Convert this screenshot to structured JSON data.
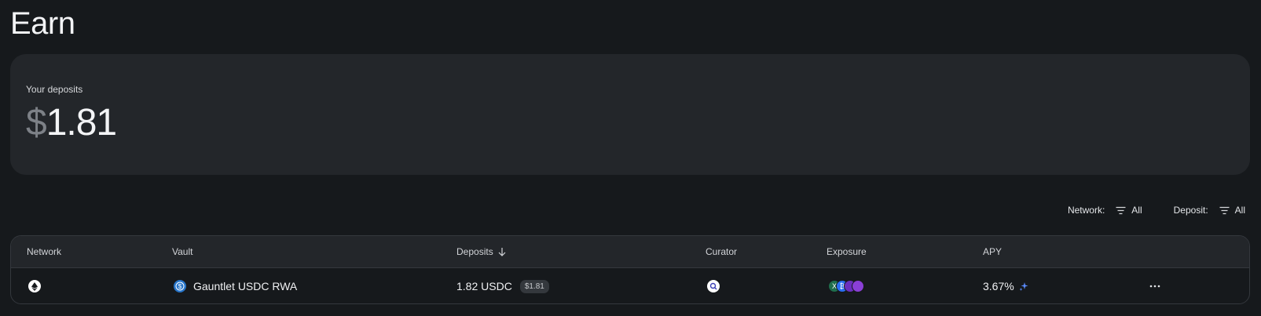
{
  "page": {
    "title": "Earn"
  },
  "summary": {
    "label": "Your deposits",
    "currency_symbol": "$",
    "amount": "1.81"
  },
  "filters": {
    "network": {
      "label": "Network:",
      "value": "All"
    },
    "deposit": {
      "label": "Deposit:",
      "value": "All"
    }
  },
  "table": {
    "columns": {
      "network": "Network",
      "vault": "Vault",
      "deposits": "Deposits",
      "curator": "Curator",
      "exposure": "Exposure",
      "apy": "APY"
    },
    "rows": [
      {
        "network_icon": "ethereum-icon",
        "vault_icon": "usdc-icon",
        "vault": "Gauntlet USDC RWA",
        "deposits": "1.82 USDC",
        "deposits_usd": "$1.81",
        "curator_icon": "gauntlet-curator-icon",
        "exposure_icons": [
          "xaut-icon",
          "wbtc-icon",
          "token-icon",
          "token-icon"
        ],
        "apy": "3.67%",
        "apy_icon": "sparkle-icon"
      }
    ]
  },
  "colors": {
    "background": "#16191c",
    "card": "#23262a",
    "accent_blue": "#2775ca",
    "sparkle": "#5b8cff"
  }
}
